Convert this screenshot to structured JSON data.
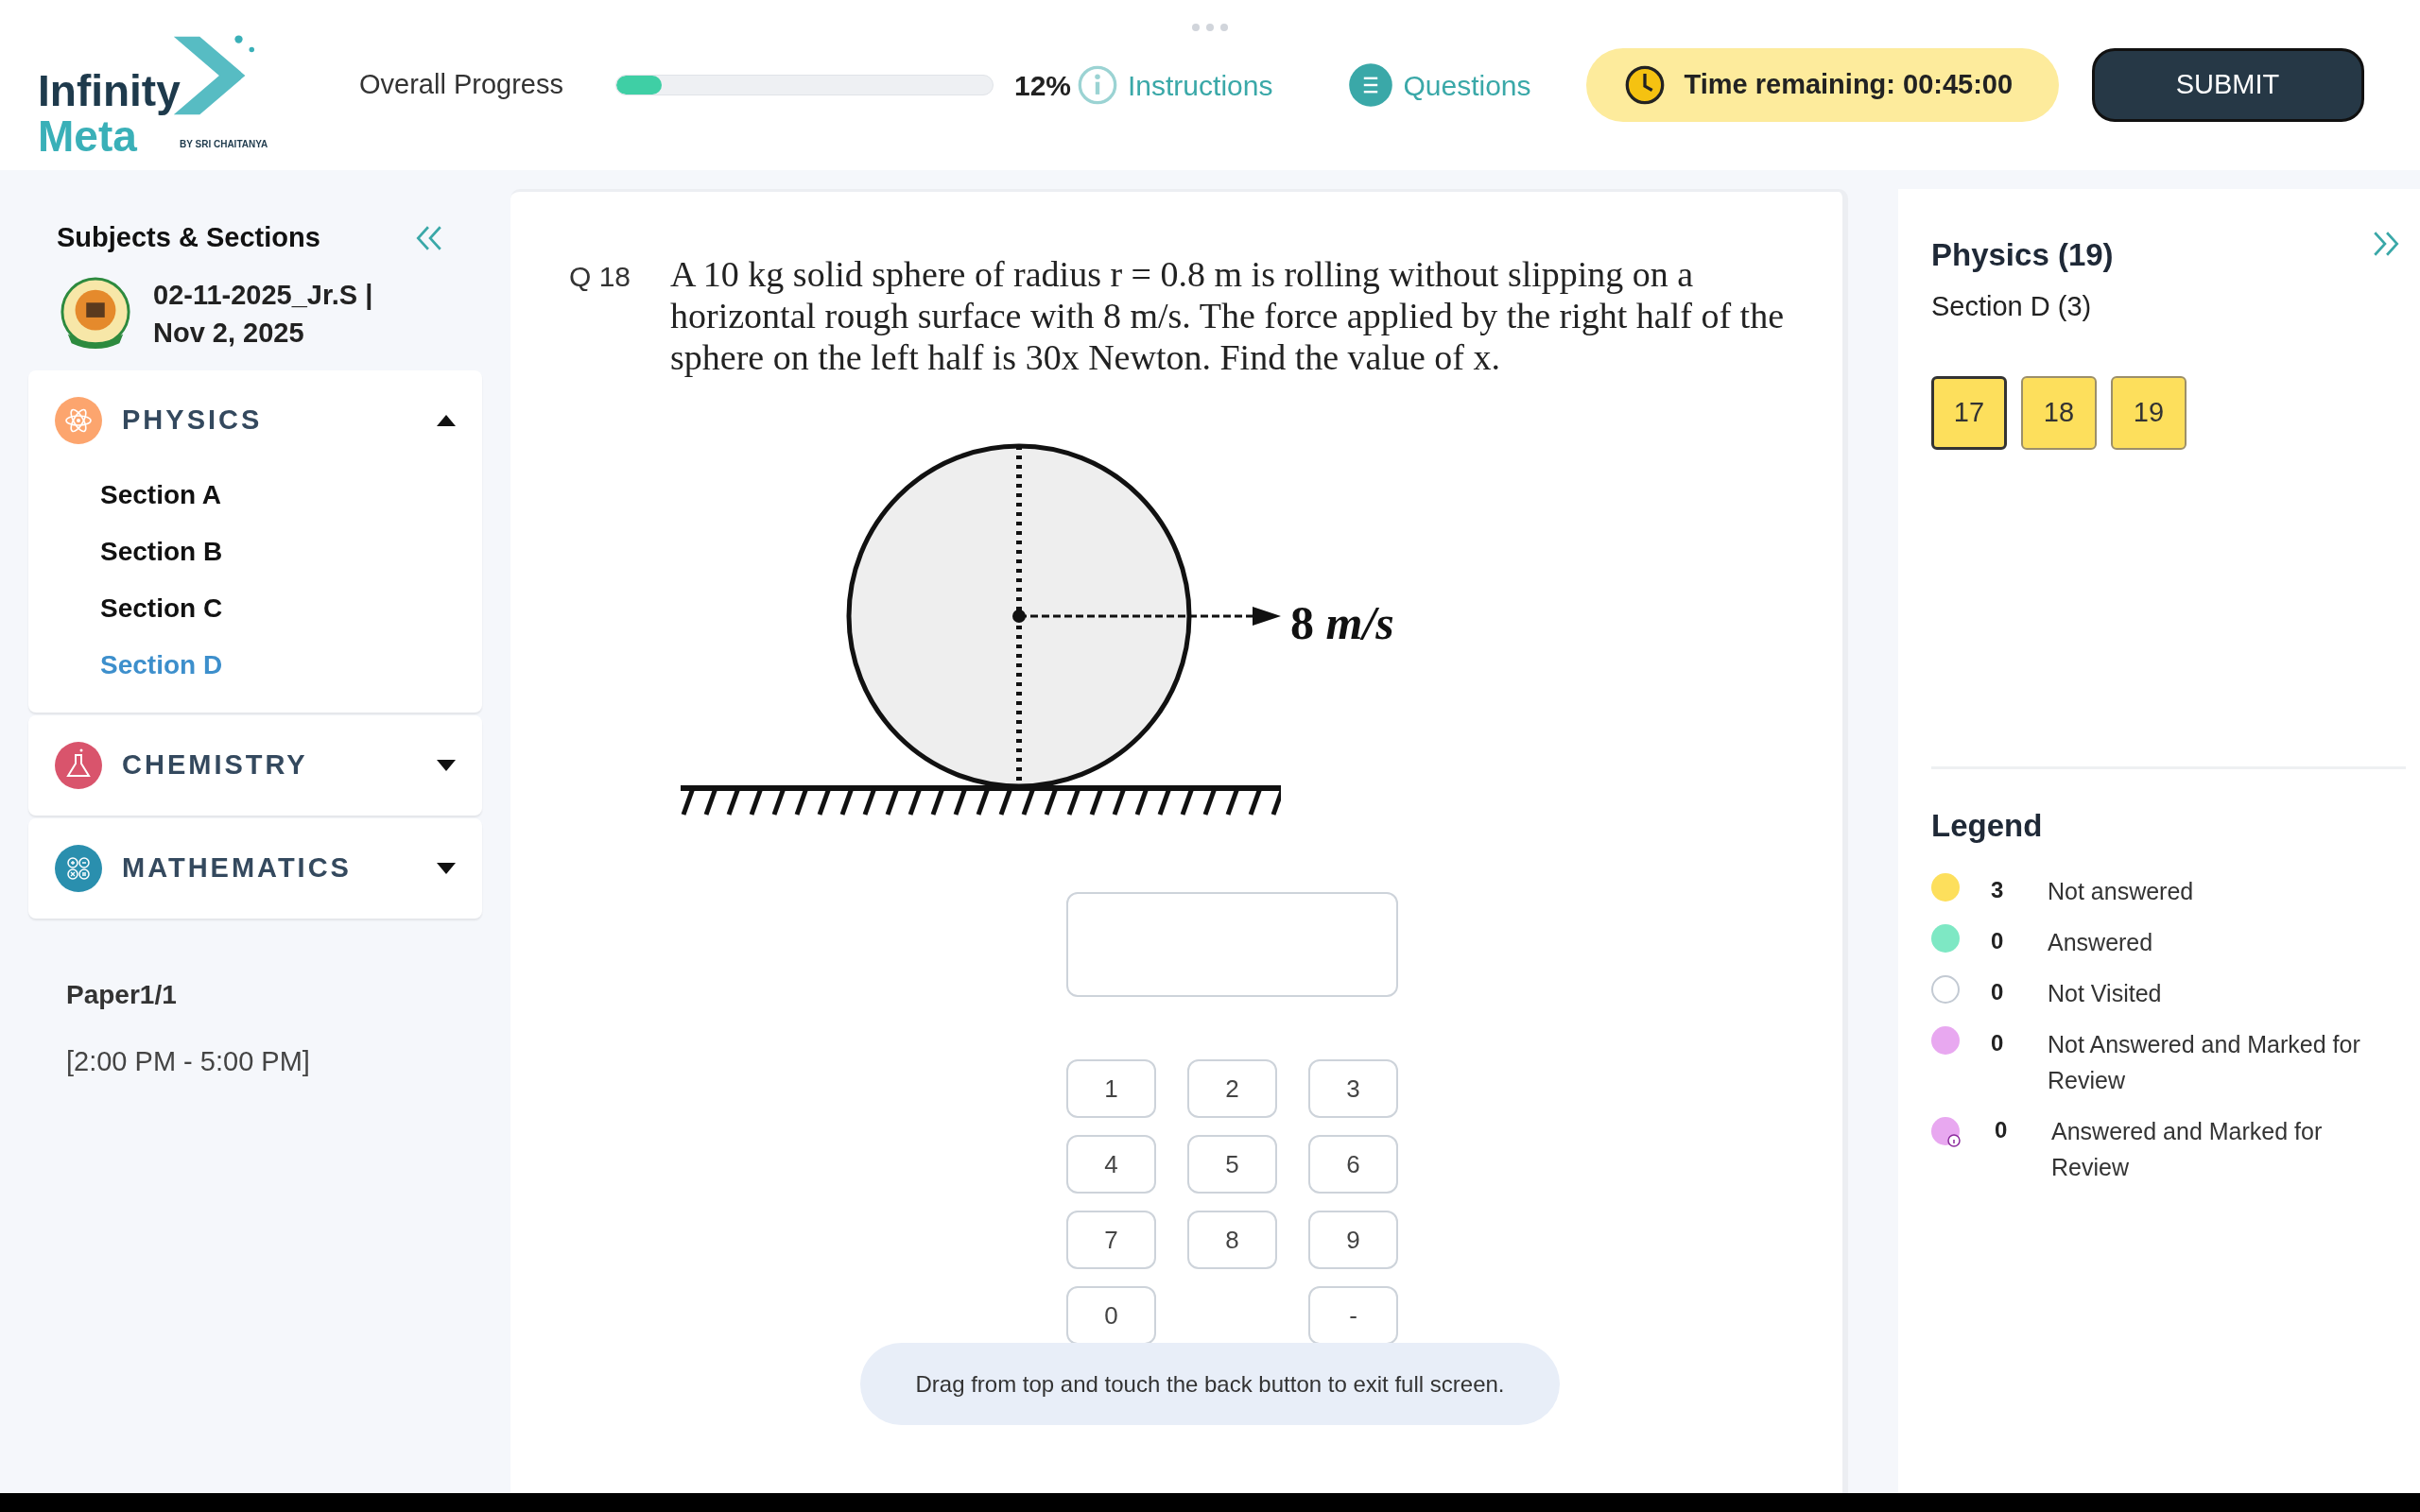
{
  "header": {
    "logo": {
      "line_1": "Infinity",
      "line_2": "Meta",
      "tagline": "BY SRI CHAITANYA"
    },
    "progress": {
      "label": "Overall Progress",
      "level": 0.12,
      "percent": "12%"
    },
    "links": [
      {
        "label": "Instructions",
        "kind": "instructions"
      },
      {
        "label": "Questions",
        "kind": "questions"
      }
    ],
    "timer": "Time remaining: 00:45:00",
    "submit": "SUBMIT"
  },
  "sidebar": {
    "title": "Subjects & Sections",
    "exam": {
      "name": "02-11-2025_Jr.S |",
      "date": "Nov 2, 2025"
    },
    "subjects": [
      {
        "name": "PHYSICS",
        "kind": "physics",
        "expanded": true,
        "sections": [
          {
            "label": "Section A",
            "selected": false
          },
          {
            "label": "Section B",
            "selected": false
          },
          {
            "label": "Section C",
            "selected": false
          },
          {
            "label": "Section D",
            "selected": true
          }
        ]
      },
      {
        "name": "CHEMISTRY",
        "kind": "chemistry",
        "expanded": false
      },
      {
        "name": "MATHEMATICS",
        "kind": "mathematics",
        "expanded": false
      }
    ],
    "paper": {
      "name": "Paper1/1",
      "time": "[2:00 PM - 5:00 PM]"
    }
  },
  "question": {
    "number": "Q 18",
    "text": "A 10 kg solid sphere of radius r = 0.8 m is rolling without slipping on a horizontal rough surface with 8 m/s. The force applied by the right half of the sphere on the left half is 30x Newton. Find the value of x.",
    "figure_label": "8 *m/s*"
  },
  "answer": {
    "keys": [
      "1",
      "2",
      "3",
      "4",
      "5",
      "6",
      "7",
      "8",
      "9",
      "0",
      "-"
    ]
  },
  "toast": "Drag from top and touch the back button to exit full screen.",
  "palette": {
    "title": "Physics (19)",
    "section": "Section D (3)",
    "questions": [
      {
        "number": "17",
        "color": "#fddf5c",
        "selected": true
      },
      {
        "number": "18",
        "color": "#fddf5c",
        "selected": false
      },
      {
        "number": "19",
        "color": "#fddf5c",
        "selected": false
      }
    ],
    "legend_title": "Legend",
    "legend": [
      {
        "kind": "not_answered",
        "count": "3",
        "label": "Not answered"
      },
      {
        "kind": "answered",
        "count": "0",
        "label": "Answered"
      },
      {
        "kind": "not_visited",
        "count": "0",
        "label": "Not Visited"
      },
      {
        "kind": "marked",
        "count": "0",
        "label": "Not Answered and Marked for Review"
      },
      {
        "kind": "answered_marked",
        "count": "0",
        "label": "Answered and Marked for Review"
      }
    ]
  }
}
